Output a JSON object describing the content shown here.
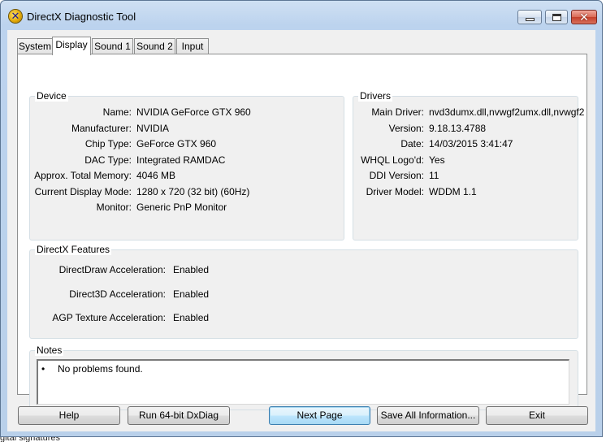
{
  "window": {
    "title": "DirectX Diagnostic Tool",
    "close_glyph": "✕",
    "app_icon_glyph": "✕"
  },
  "tabs": [
    {
      "label": "System",
      "active": false
    },
    {
      "label": "Display",
      "active": true
    },
    {
      "label": "Sound 1",
      "active": false
    },
    {
      "label": "Sound 2",
      "active": false
    },
    {
      "label": "Input",
      "active": false
    }
  ],
  "device": {
    "title": "Device",
    "rows": [
      {
        "label": "Name:",
        "value": "NVIDIA GeForce GTX 960"
      },
      {
        "label": "Manufacturer:",
        "value": "NVIDIA"
      },
      {
        "label": "Chip Type:",
        "value": "GeForce GTX 960"
      },
      {
        "label": "DAC Type:",
        "value": "Integrated RAMDAC"
      },
      {
        "label": "Approx. Total Memory:",
        "value": "4046 MB"
      },
      {
        "label": "Current Display Mode:",
        "value": "1280 x 720 (32 bit) (60Hz)"
      },
      {
        "label": "Monitor:",
        "value": "Generic PnP Monitor"
      }
    ]
  },
  "drivers": {
    "title": "Drivers",
    "rows": [
      {
        "label": "Main Driver:",
        "value": "nvd3dumx.dll,nvwgf2umx.dll,nvwgf2"
      },
      {
        "label": "Version:",
        "value": "9.18.13.4788"
      },
      {
        "label": "Date:",
        "value": "14/03/2015 3:41:47"
      },
      {
        "label": "WHQL Logo'd:",
        "value": "Yes"
      },
      {
        "label": "DDI Version:",
        "value": "11"
      },
      {
        "label": "Driver Model:",
        "value": "WDDM 1.1"
      }
    ]
  },
  "features": {
    "title": "DirectX Features",
    "rows": [
      {
        "label": "DirectDraw Acceleration:",
        "value": "Enabled"
      },
      {
        "label": "Direct3D Acceleration:",
        "value": "Enabled"
      },
      {
        "label": "AGP Texture Acceleration:",
        "value": "Enabled"
      }
    ]
  },
  "notes": {
    "title": "Notes",
    "bullet": "•",
    "text": "No problems found."
  },
  "buttons": {
    "help": "Help",
    "run64": "Run 64-bit DxDiag",
    "next": "Next Page",
    "save": "Save All Information...",
    "exit": "Exit"
  },
  "background_text": "gital signatures",
  "colors": {
    "title_bar": "#bcd3ee",
    "close_button": "#c4402b",
    "default_button": "#bee6fd",
    "dialog_bg": "#f0f0f0"
  }
}
